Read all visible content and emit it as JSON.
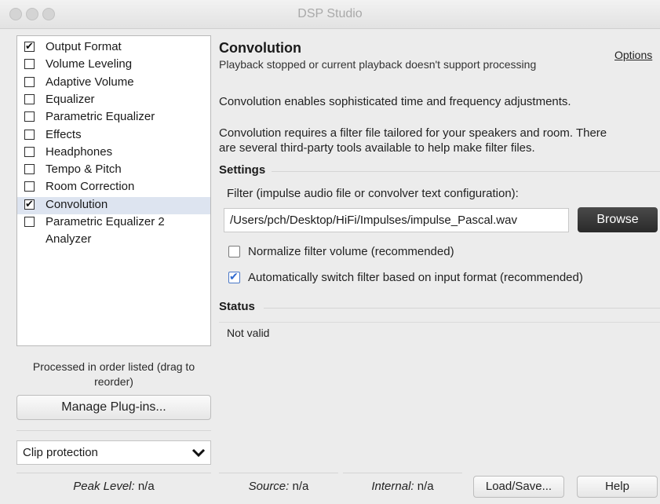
{
  "window": {
    "title": "DSP Studio"
  },
  "plugins": [
    {
      "label": "Output Format",
      "checked": true,
      "checkbox": true,
      "selected": false
    },
    {
      "label": "Volume Leveling",
      "checked": false,
      "checkbox": true,
      "selected": false
    },
    {
      "label": "Adaptive Volume",
      "checked": false,
      "checkbox": true,
      "selected": false
    },
    {
      "label": "Equalizer",
      "checked": false,
      "checkbox": true,
      "selected": false
    },
    {
      "label": "Parametric Equalizer",
      "checked": false,
      "checkbox": true,
      "selected": false
    },
    {
      "label": "Effects",
      "checked": false,
      "checkbox": true,
      "selected": false
    },
    {
      "label": "Headphones",
      "checked": false,
      "checkbox": true,
      "selected": false
    },
    {
      "label": "Tempo & Pitch",
      "checked": false,
      "checkbox": true,
      "selected": false
    },
    {
      "label": "Room Correction",
      "checked": false,
      "checkbox": true,
      "selected": false
    },
    {
      "label": "Convolution",
      "checked": true,
      "checkbox": true,
      "selected": true
    },
    {
      "label": "Parametric Equalizer 2",
      "checked": false,
      "checkbox": true,
      "selected": false
    },
    {
      "label": "Analyzer",
      "checked": false,
      "checkbox": false,
      "selected": false
    }
  ],
  "sidebar": {
    "order_note": "Processed in order listed (drag to reorder)",
    "manage_label": "Manage Plug-ins...",
    "clip_value": "Clip protection"
  },
  "statusbar": {
    "peak_label": "Peak Level:",
    "peak_value": "n/a",
    "source_label": "Source:",
    "source_value": "n/a",
    "internal_label": "Internal:",
    "internal_value": "n/a",
    "load_save_label": "Load/Save...",
    "help_label": "Help"
  },
  "main": {
    "title": "Convolution",
    "subtitle": "Playback stopped or current playback doesn't support processing",
    "options_label": "Options",
    "desc1": "Convolution enables sophisticated time and frequency adjustments.",
    "desc2a": "Convolution requires a filter file tailored for your speakers and room.  There",
    "desc2b": "are several third-party tools available to help make filter files.",
    "settings_title": "Settings",
    "filter_label": "Filter (impulse audio file or convolver text configuration):",
    "filter_value": "/Users/pch/Desktop/HiFi/Impulses/impulse_Pascal.wav",
    "browse_label": "Browse",
    "normalize_label": "Normalize filter volume (recommended)",
    "normalize_checked": false,
    "autoswitch_label": "Automatically switch filter based on input format (recommended)",
    "autoswitch_checked": true,
    "status_title": "Status",
    "status_value": "Not valid"
  }
}
